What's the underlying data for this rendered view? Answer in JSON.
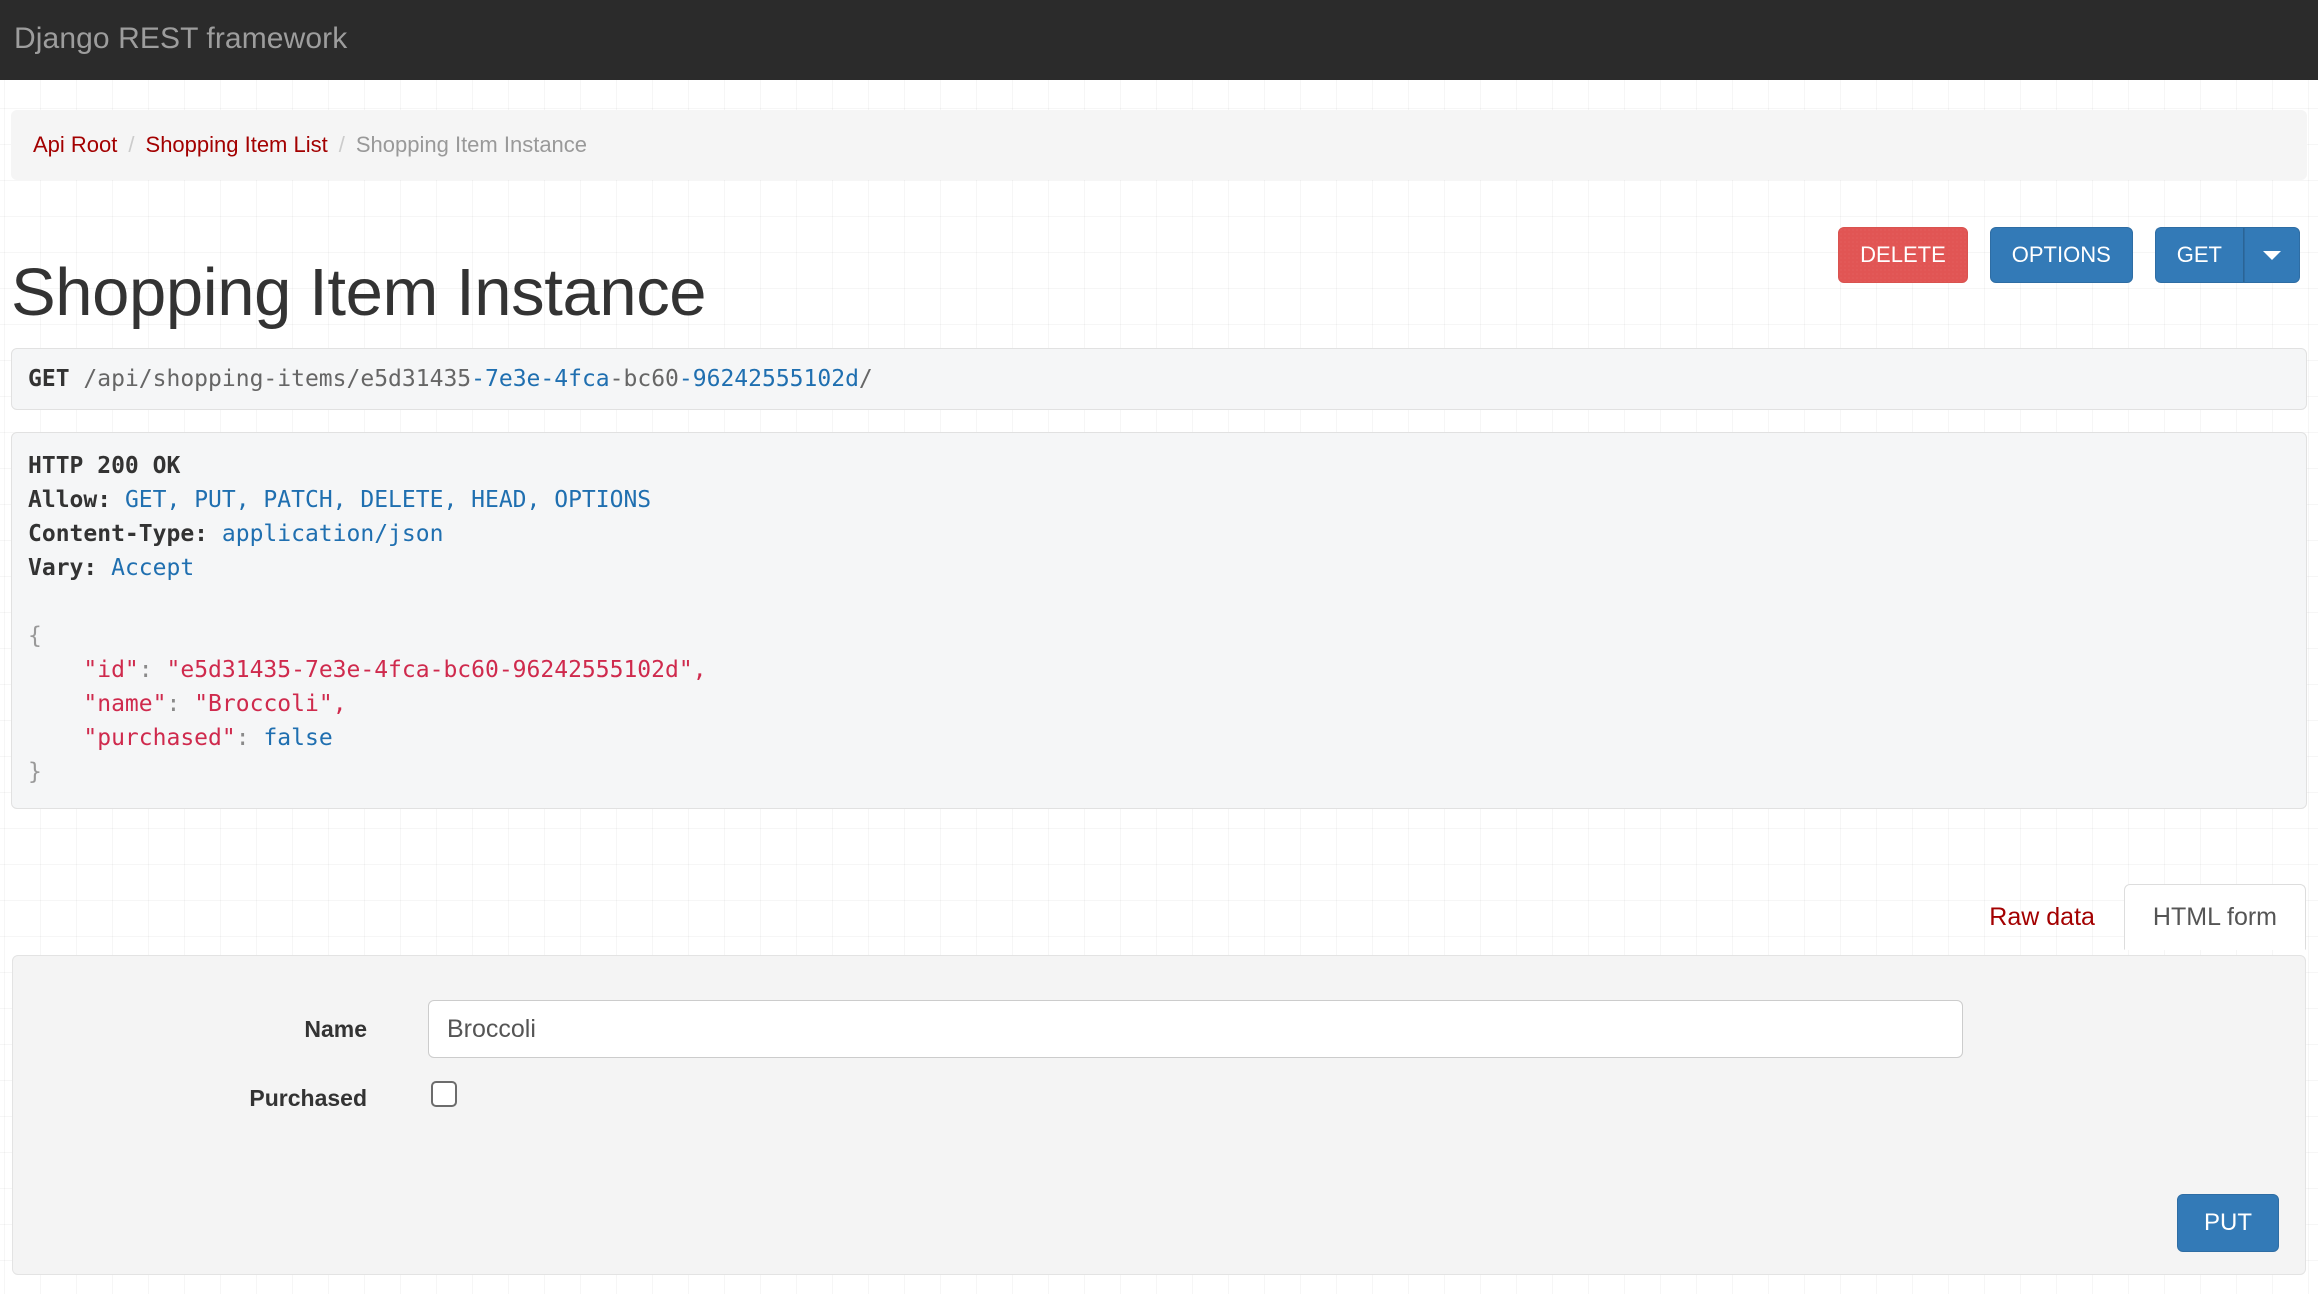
{
  "navbar": {
    "brand": "Django REST framework"
  },
  "breadcrumb": {
    "items": [
      {
        "label": "Api Root",
        "active": false
      },
      {
        "label": "Shopping Item List",
        "active": false
      },
      {
        "label": "Shopping Item Instance",
        "active": true
      }
    ],
    "separator": "/"
  },
  "header": {
    "title": "Shopping Item Instance",
    "buttons": {
      "delete": "DELETE",
      "options": "OPTIONS",
      "get": "GET",
      "caret_icon": "caret-down-icon"
    }
  },
  "request": {
    "method": "GET",
    "path_prefix": "/api/shopping-items/",
    "id_seg_1": "e5d31435",
    "id_seg_2": "7e3e",
    "id_seg_3": "4fca",
    "id_seg_4": "bc60",
    "id_seg_5": "96242555102d",
    "dash": "-",
    "trailing_slash": "/"
  },
  "response": {
    "status_line": "HTTP 200 OK",
    "headers": [
      {
        "name": "Allow:",
        "value": "GET, PUT, PATCH, DELETE, HEAD, OPTIONS"
      },
      {
        "name": "Content-Type:",
        "value": "application/json"
      },
      {
        "name": "Vary:",
        "value": "Accept"
      }
    ],
    "body": {
      "open_brace": "{",
      "close_brace": "}",
      "lines": [
        {
          "key": "\"id\"",
          "colon": ":",
          "value": "\"e5d31435-7e3e-4fca-bc60-96242555102d\"",
          "value_type": "string",
          "comma": ","
        },
        {
          "key": "\"name\"",
          "colon": ":",
          "value": "\"Broccoli\"",
          "value_type": "string",
          "comma": ","
        },
        {
          "key": "\"purchased\"",
          "colon": ":",
          "value": "false",
          "value_type": "literal",
          "comma": ""
        }
      ]
    }
  },
  "tabs": [
    {
      "label": "Raw data",
      "active": false
    },
    {
      "label": "HTML form",
      "active": true
    }
  ],
  "form": {
    "fields": [
      {
        "label": "Name",
        "value": "Broccoli",
        "placeholder": "",
        "type": "text"
      },
      {
        "label": "Purchased",
        "checked": false,
        "type": "checkbox"
      }
    ],
    "submit_label": "PUT"
  },
  "colors": {
    "navbar_bg": "#2b2b2b",
    "navbar_text": "#9d9d9d",
    "link": "#a30000",
    "primary": "#337ab7",
    "danger": "#e15554",
    "panel_bg": "#f5f6f7",
    "json_key": "#cf2a4d",
    "json_literal": "#1f6fb0"
  }
}
